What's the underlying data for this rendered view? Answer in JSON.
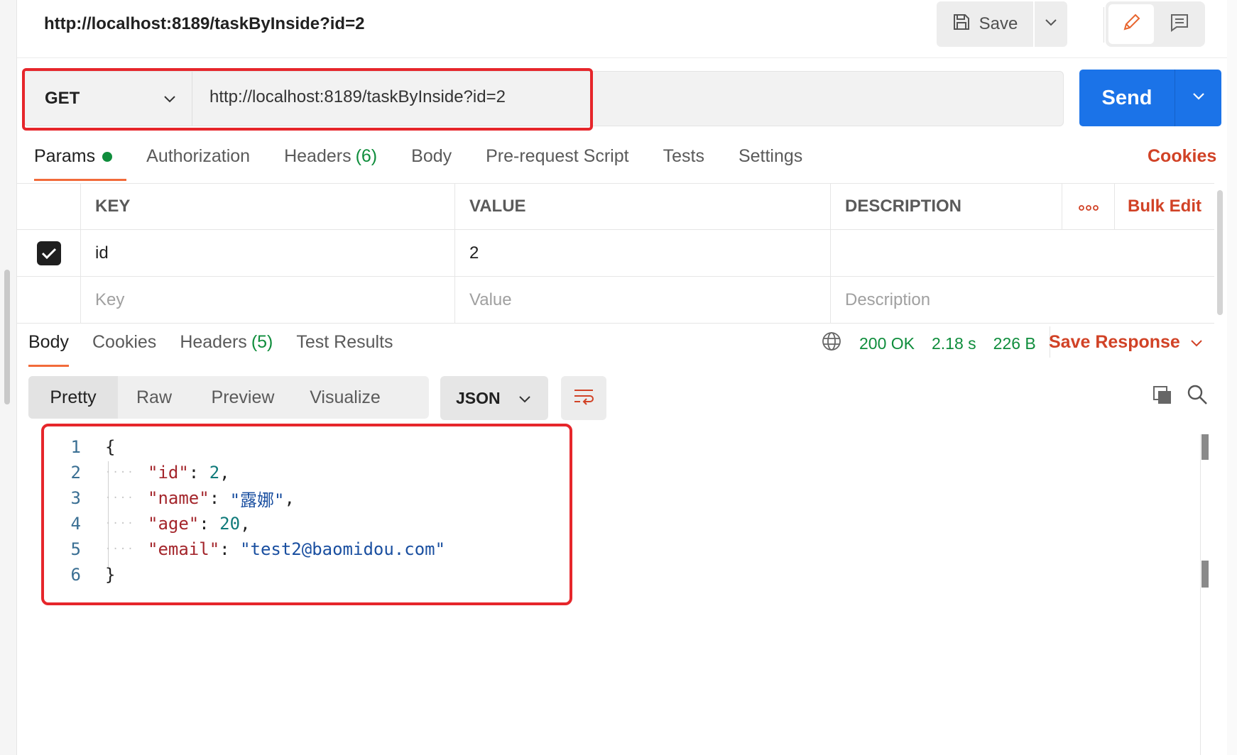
{
  "title_bar": {
    "request_name": "http://localhost:8189/taskByInside?id=2",
    "save_label": "Save"
  },
  "request": {
    "method": "GET",
    "url": "http://localhost:8189/taskByInside?id=2",
    "send_label": "Send"
  },
  "request_tabs": {
    "params": "Params",
    "authorization": "Authorization",
    "headers": "Headers",
    "headers_count": "(6)",
    "body": "Body",
    "pre_request": "Pre-request Script",
    "tests": "Tests",
    "settings": "Settings",
    "cookies": "Cookies"
  },
  "params_table": {
    "headers": {
      "key": "KEY",
      "value": "VALUE",
      "description": "DESCRIPTION",
      "bulk_edit": "Bulk Edit"
    },
    "rows": [
      {
        "checked": true,
        "key": "id",
        "value": "2",
        "description": ""
      }
    ],
    "placeholders": {
      "key": "Key",
      "value": "Value",
      "description": "Description"
    }
  },
  "response_tabs": {
    "body": "Body",
    "cookies": "Cookies",
    "headers": "Headers",
    "headers_count": "(5)",
    "test_results": "Test Results"
  },
  "response_meta": {
    "status": "200 OK",
    "time": "2.18 s",
    "size": "226 B",
    "save_response": "Save Response"
  },
  "format_bar": {
    "pretty": "Pretty",
    "raw": "Raw",
    "preview": "Preview",
    "visualize": "Visualize",
    "language": "JSON"
  },
  "response_body": {
    "line_numbers": [
      "1",
      "2",
      "3",
      "4",
      "5",
      "6"
    ],
    "open_brace": "{",
    "close_brace": "}",
    "fields": [
      {
        "key": "\"id\"",
        "value": "2",
        "type": "number",
        "comma": ","
      },
      {
        "key": "\"name\"",
        "value": "\"露娜\"",
        "type": "string",
        "comma": ","
      },
      {
        "key": "\"age\"",
        "value": "20",
        "type": "number",
        "comma": ","
      },
      {
        "key": "\"email\"",
        "value": "\"test2@baomidou.com\"",
        "type": "string",
        "comma": ""
      }
    ]
  },
  "colors": {
    "accent_orange": "#f26b3a",
    "send_blue": "#1b73e8",
    "status_green": "#0f8d3c",
    "link_red": "#d14226",
    "highlight_red": "#e6262b"
  }
}
